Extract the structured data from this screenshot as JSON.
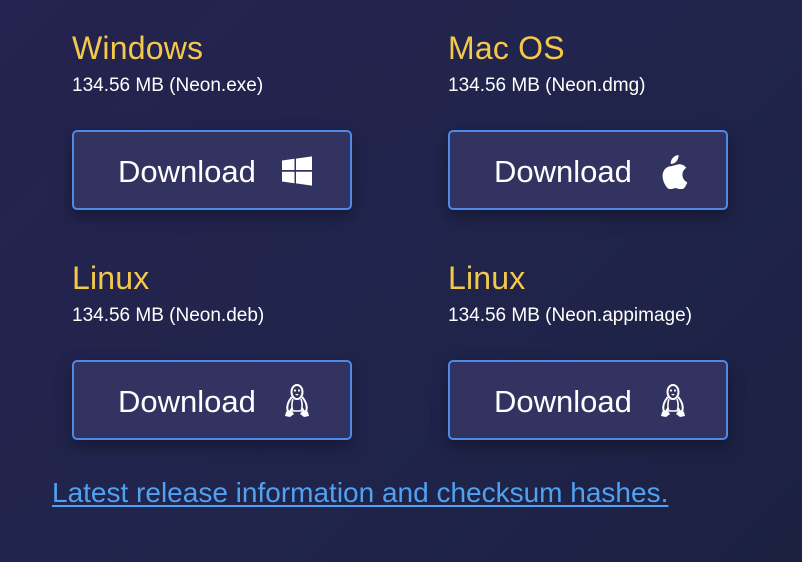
{
  "downloads": [
    {
      "name": "Windows",
      "size": "134.56 MB (Neon.exe)",
      "button_label": "Download",
      "icon": "windows-icon"
    },
    {
      "name": "Mac OS",
      "size": "134.56 MB (Neon.dmg)",
      "button_label": "Download",
      "icon": "apple-icon"
    },
    {
      "name": "Linux",
      "size": "134.56 MB (Neon.deb)",
      "button_label": "Download",
      "icon": "linux-icon"
    },
    {
      "name": "Linux",
      "size": "134.56 MB (Neon.appimage)",
      "button_label": "Download",
      "icon": "linux-icon"
    }
  ],
  "release_link": "Latest release information and checksum hashes.",
  "colors": {
    "background": "#22234c",
    "heading": "#f4c94a",
    "button_bg": "#333362",
    "button_border": "#4d8ae6",
    "link": "#4fa2f2"
  }
}
